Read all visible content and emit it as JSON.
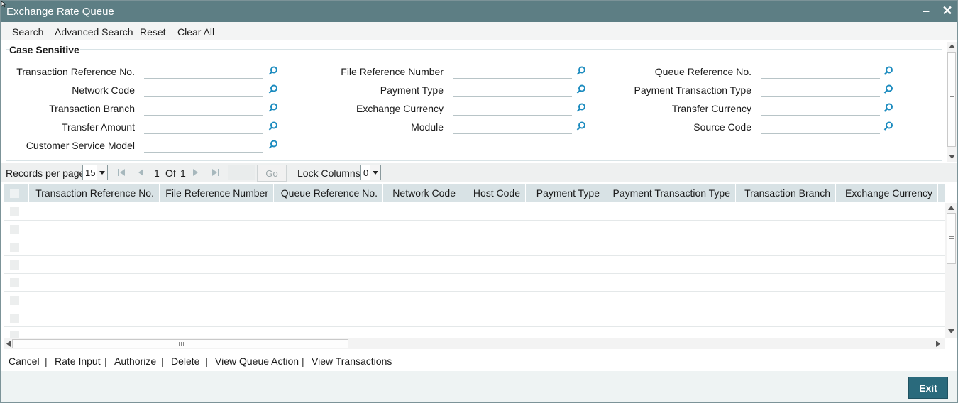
{
  "window": {
    "title": "Exchange Rate Queue"
  },
  "toolbar": {
    "search": "Search",
    "advanced_search": "Advanced Search",
    "reset": "Reset",
    "clear_all": "Clear All"
  },
  "criteria": {
    "legend": "Case Sensitive",
    "fields": {
      "txn_ref": "Transaction Reference No.",
      "file_ref": "File Reference Number",
      "queue_ref": "Queue Reference No.",
      "network_code": "Network Code",
      "payment_type": "Payment Type",
      "payment_txn_type": "Payment Transaction Type",
      "txn_branch": "Transaction Branch",
      "exchange_currency": "Exchange Currency",
      "transfer_currency": "Transfer Currency",
      "transfer_amount": "Transfer Amount",
      "module": "Module",
      "source_code": "Source Code",
      "customer_service_model": "Customer Service Model"
    }
  },
  "pagination": {
    "records_label": "Records per page",
    "records_value": "15",
    "current_page": "1",
    "of_label": "Of",
    "total_pages": "1",
    "go_label": "Go",
    "lock_label": "Lock Columns",
    "lock_value": "0"
  },
  "grid": {
    "columns": [
      "Transaction Reference No.",
      "File Reference Number",
      "Queue Reference No.",
      "Network Code",
      "Host Code",
      "Payment Type",
      "Payment Transaction Type",
      "Transaction Branch",
      "Exchange Currency"
    ]
  },
  "actions": {
    "cancel": "Cancel",
    "rate_input": "Rate Input",
    "authorize": "Authorize",
    "delete": "Delete",
    "view_queue_action": "View Queue Action",
    "view_transactions": "View Transactions"
  },
  "footer": {
    "exit": "Exit"
  },
  "colors": {
    "titlebar": "#5d7e84",
    "header": "#d8e2e5",
    "exit_button": "#2a6a7c",
    "lens_icon": "#1b8bbf"
  }
}
